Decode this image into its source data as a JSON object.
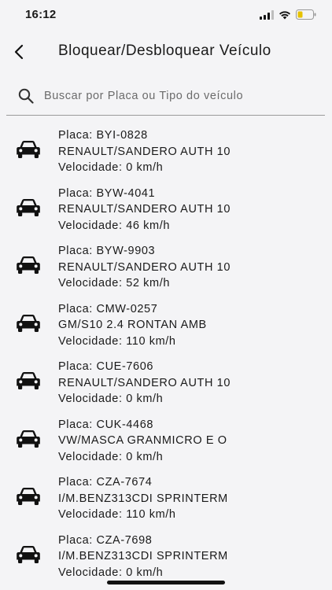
{
  "status_bar": {
    "time": "16:12",
    "icons": [
      "signal-icon",
      "wifi-icon",
      "battery-icon"
    ]
  },
  "header": {
    "title": "Bloquear/Desbloquear Veículo",
    "back_icon": "chevron-left-icon"
  },
  "search": {
    "placeholder": "Buscar por Placa ou Tipo do veículo",
    "value": "",
    "icon": "search-icon"
  },
  "vehicles": [
    {
      "plate": "Placa: BYI-0828",
      "model": "RENAULT/SANDERO AUTH 10",
      "speed": "Velocidade: 0 km/h"
    },
    {
      "plate": "Placa: BYW-4041",
      "model": "RENAULT/SANDERO AUTH 10",
      "speed": "Velocidade: 46 km/h"
    },
    {
      "plate": "Placa: BYW-9903",
      "model": "RENAULT/SANDERO AUTH 10",
      "speed": "Velocidade: 52 km/h"
    },
    {
      "plate": "Placa: CMW-0257",
      "model": "GM/S10 2.4 RONTAN AMB",
      "speed": "Velocidade: 110 km/h"
    },
    {
      "plate": "Placa: CUE-7606",
      "model": "RENAULT/SANDERO AUTH 10",
      "speed": "Velocidade: 0 km/h"
    },
    {
      "plate": "Placa: CUK-4468",
      "model": "VW/MASCA GRANMICRO E O",
      "speed": "Velocidade: 0 km/h"
    },
    {
      "plate": "Placa: CZA-7674",
      "model": "I/M.BENZ313CDI SPRINTERM",
      "speed": "Velocidade: 110 km/h"
    },
    {
      "plate": "Placa: CZA-7698",
      "model": "I/M.BENZ313CDI SPRINTERM",
      "speed": "Velocidade: 0 km/h"
    }
  ],
  "colors": {
    "background": "#f4f4f6",
    "text": "#1a1a1a",
    "divider": "#9a9a9a"
  }
}
